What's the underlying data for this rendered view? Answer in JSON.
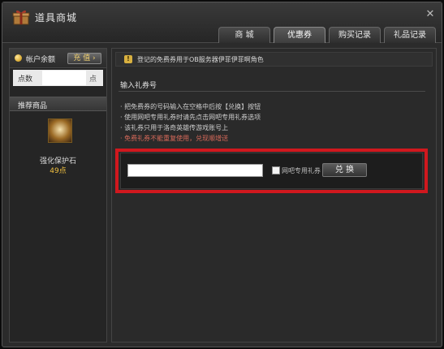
{
  "window": {
    "title": "道具商城",
    "close_symbol": "✕"
  },
  "tabs": [
    {
      "label": "商 城",
      "active": false
    },
    {
      "label": "优惠券",
      "active": true
    },
    {
      "label": "购买记录",
      "active": false
    },
    {
      "label": "礼品记录",
      "active": false
    }
  ],
  "sidebar": {
    "balance_label": "帐户余额",
    "recharge_label": "充 值 ›",
    "points_label": "点数",
    "points_value": "",
    "points_unit": "点",
    "recommend_title": "推荐商品",
    "item": {
      "name": "强化保护石",
      "price": "49点"
    }
  },
  "content": {
    "notice_icon": "!",
    "notice_text": "登记的免费券用于OB服务器伊菲伊菲啊角色",
    "section_title": "输入礼券号",
    "instructions": [
      "把免费券的号码输入在空格中后按【兑换】按钮",
      "使用网吧专用礼券时请先点击网吧专用礼券选项",
      "该礼券只用于洛奇英雄传游戏账号上"
    ],
    "warning": "免费礼券不能重复使用，兑现顺增送",
    "code_input": {
      "value": "",
      "placeholder": ""
    },
    "netbar_checkbox_label": "网吧专用礼券",
    "redeem_label": "兑 换"
  },
  "colors": {
    "highlight_border": "#d0181e",
    "price_gold": "#f0c040",
    "warning_text": "#d86a5a"
  },
  "icons": [
    "gift-box-icon",
    "close-icon",
    "coin-icon",
    "notice-icon",
    "item-image"
  ]
}
